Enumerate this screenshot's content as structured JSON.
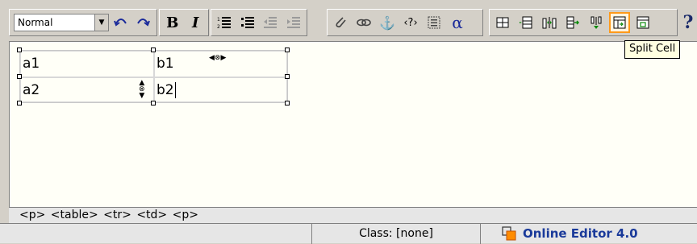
{
  "toolbar": {
    "paragraph_style": {
      "value": "Normal"
    },
    "buttons": [
      {
        "name": "undo-icon",
        "glyph": "↶"
      },
      {
        "name": "redo-icon",
        "glyph": "↷"
      },
      {
        "name": "bold",
        "label": "B"
      },
      {
        "name": "italic",
        "label": "I"
      },
      {
        "name": "ordered-list-icon"
      },
      {
        "name": "unordered-list-icon"
      },
      {
        "name": "outdent-icon"
      },
      {
        "name": "indent-icon"
      },
      {
        "name": "attachment-icon"
      },
      {
        "name": "link-icon"
      },
      {
        "name": "anchor-icon",
        "glyph": "⚓"
      },
      {
        "name": "code-icon",
        "label": "‹?›"
      },
      {
        "name": "div-icon"
      },
      {
        "name": "special-char",
        "label": "α"
      },
      {
        "name": "insert-table-icon"
      },
      {
        "name": "insert-row-icon"
      },
      {
        "name": "insert-column-icon"
      },
      {
        "name": "merge-cells-icon"
      },
      {
        "name": "delete-column-icon"
      },
      {
        "name": "split-cell-icon"
      },
      {
        "name": "cell-properties-icon"
      }
    ],
    "help_label": "?",
    "tooltip": "Split Cell",
    "accent_color": "#ff9a1a"
  },
  "editor": {
    "table": [
      [
        "a1",
        "b1"
      ],
      [
        "a2",
        "b2"
      ]
    ]
  },
  "path_bar": "<p> <table> <tr> <td> <p>",
  "status": {
    "class_label": "Class: [none]",
    "brand": "Online Editor 4.0",
    "brand_color": "#1a3a9a"
  }
}
